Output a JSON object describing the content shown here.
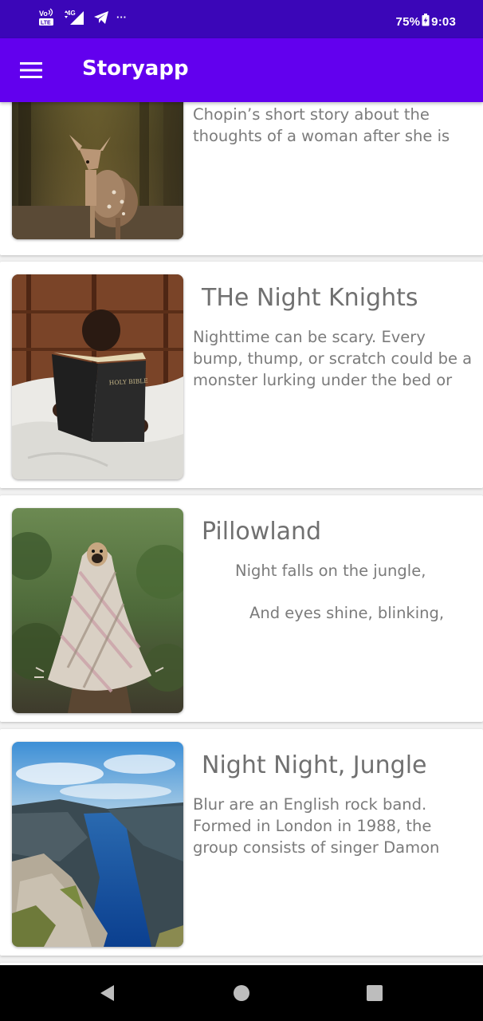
{
  "status_bar": {
    "battery": "75%",
    "time": "9:03",
    "more_indicator": "···",
    "icons": [
      "volte-icon",
      "signal-4g-icon",
      "telegram-icon",
      "battery-charging-icon"
    ]
  },
  "app_bar": {
    "title": "Storyapp",
    "menu_icon": "hamburger-menu-icon"
  },
  "stories": [
    {
      "title": "",
      "description": "The Story of an Hour is Kate Chopin’s short story about the thoughts of a woman after she is",
      "image": "fawn-in-forest"
    },
    {
      "title": "THe Night Knights",
      "description": "Nighttime can be scary. Every bump, thump, or scratch could be a monster lurking under the bed or",
      "image": "child-reading-holy-bible",
      "image_text": "HOLY BIBLE"
    },
    {
      "title": "Pillowland",
      "lines": [
        "Night falls on the jungle,",
        "And eyes shine, blinking,"
      ],
      "image": "pug-wrapped-in-blanket"
    },
    {
      "title": "Night Night, Jungle",
      "description": "Blur are an English rock band. Formed in London in 1988, the group consists of singer Damon",
      "image": "fjord-landscape"
    }
  ],
  "colors": {
    "status_bar": "#3b06b8",
    "app_bar": "#6200ee",
    "title_text": "#707070",
    "body_text": "#7b7b7b"
  },
  "nav_bar": {
    "back_icon": "back-triangle-icon",
    "home_icon": "home-circle-icon",
    "recents_icon": "recents-square-icon"
  }
}
